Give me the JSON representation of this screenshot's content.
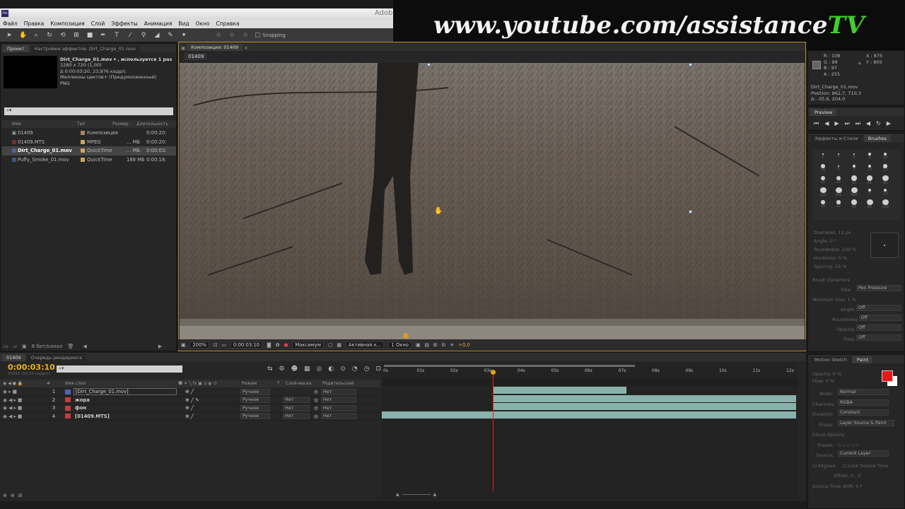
{
  "app": {
    "title": "Adobe",
    "menu": [
      "Файл",
      "Правка",
      "Композиция",
      "Слой",
      "Эффекты",
      "Анимация",
      "Вид",
      "Окно",
      "Справка"
    ],
    "snapping": "Snapping"
  },
  "banner": {
    "text": "www.youtube.com/assistance",
    "accent": "TV"
  },
  "project": {
    "tabs": [
      "Проект",
      "Настройки эффектов: Dirt_Charge_01.mov"
    ],
    "selected_name": "Dirt_Charge_01.mov ▾ , используется 1 раз",
    "info": [
      "1280 x 720 (1,00)",
      "Δ 0:00:03:20, 23,976 кадр/с",
      "Миллионы цветов+ (Предумноженный)",
      "PNG"
    ],
    "search_placeholder": "⌕▾",
    "columns": [
      "Имя",
      "Тип",
      "Размер",
      "Длительность"
    ],
    "items": [
      {
        "name": "01409",
        "type": "Композиция",
        "size": "",
        "duration": "0:00:20:",
        "color": "#a3865a"
      },
      {
        "name": "01409.MTS",
        "type": "MPEG",
        "size": "... МБ",
        "duration": "0:00:20:",
        "color": "#c9a45a"
      },
      {
        "name": "Dirt_Charge_01.mov",
        "type": "QuickTime",
        "size": "... МБ",
        "duration": "0:00:03:",
        "color": "#c9a45a"
      },
      {
        "name": "Puffy_Smoke_01.mov",
        "type": "QuickTime",
        "size": "188 МБ",
        "duration": "0:00:18:",
        "color": "#c9a45a"
      }
    ],
    "bit_depth": "8 бит/канал"
  },
  "composition": {
    "tab": "Композиция: 01409",
    "sub_tab": "01409",
    "zoom": "200%",
    "timecode": "0:00:03:10",
    "resolution": "Максимум",
    "camera": "Активная к...",
    "views": "1 Окно",
    "exposure": "+0,0"
  },
  "info_panel": {
    "r": "R : 108",
    "g": "G : 99",
    "b": "B : 97",
    "a": "A : 255",
    "x": "X : 875",
    "y": "Y : 805",
    "file": "Dirt_Charge_01.mov",
    "position": "Position: 862,7, 710,3",
    "delta": "Δ: -35,6, 204,0"
  },
  "preview": {
    "tab": "Preview"
  },
  "brushes": {
    "tabs": [
      "Эффекты и Стили",
      "Brushes"
    ],
    "sizes": [
      "1",
      "3",
      "5",
      "9",
      "13",
      "19",
      "5",
      "9",
      "13",
      "17",
      "21",
      "27",
      "35",
      "45",
      "65",
      "100",
      "200",
      "300",
      "9",
      "13",
      "19",
      "17",
      "45",
      "65",
      "100"
    ],
    "diameter": "Diameter: 13 px",
    "angle": "Angle: 0 °",
    "roundness": "Roundness: 100 %",
    "hardness": "Hardness: 0 %",
    "spacing": "Spacing: 25 %",
    "dynamics": "Brush Dynamics",
    "size": "Size:",
    "size_val": "Pen Pressure",
    "min_size": "Minimum Size: 1 %",
    "angle2": "Angle:",
    "roundness2": "Roundness:",
    "opacity2": "Opacity:",
    "flow2": "Flow:",
    "off": "Off"
  },
  "paint": {
    "tabs": [
      "Motion Sketch",
      "Paint"
    ],
    "opacity": "Opacity: 0 %",
    "flow": "Flow: 0 %",
    "mode_label": "Mode:",
    "mode": "Normal",
    "channels_label": "Channels:",
    "channels": "RGBA",
    "duration_label": "Duration:",
    "duration": "Constant",
    "erase_label": "Erase:",
    "erase": "Layer Source & Paint",
    "clone": "Clone Options",
    "preset": "Preset:",
    "source_label": "Source:",
    "source": "Current Layer",
    "aligned": "Aligned",
    "lock": "Lock Source Time",
    "offset": "Offset: 0 ,  0",
    "time_shift": "Source Time Shift: 0 f",
    "fg_color": "#e8151b",
    "bg_color": "#ffffff"
  },
  "timeline": {
    "tabs": [
      "01409",
      "Очередь рендеринга"
    ],
    "timecode": "0:00:03:10",
    "frame_info": "00160 (50,00 кадр/с)",
    "columns": {
      "num": "#",
      "name": "Имя слоя",
      "mode": "Режим",
      "t": "T",
      "trkmat": "Слой-маска",
      "parent": "Родительский"
    },
    "ruler": [
      "0s",
      "01s",
      "02s",
      "03s",
      "04s",
      "05s",
      "06s",
      "07s",
      "08s",
      "09s",
      "10s",
      "11s",
      "12s"
    ],
    "layers": [
      {
        "num": "1",
        "name": "[Dirt_Charge_01.mov]",
        "mode": "Ручное",
        "trkmat": "",
        "parent": "Нет",
        "color": "#4f62b8",
        "start": 0.268,
        "end": 0.59
      },
      {
        "num": "2",
        "name": "жора",
        "mode": "Ручное",
        "trkmat": "Нет",
        "parent": "Нет",
        "color": "#c23c3c",
        "start": 0.268,
        "end": 1.0
      },
      {
        "num": "3",
        "name": "фон",
        "mode": "Ручное",
        "trkmat": "Нет",
        "parent": "Нет",
        "color": "#c23c3c",
        "start": 0.268,
        "end": 1.0
      },
      {
        "num": "4",
        "name": "[01409.MTS]",
        "mode": "Ручное",
        "trkmat": "Нет",
        "parent": "Нет",
        "color": "#c23c3c",
        "start": 0.0,
        "end": 1.0
      }
    ],
    "playhead": 0.268
  }
}
